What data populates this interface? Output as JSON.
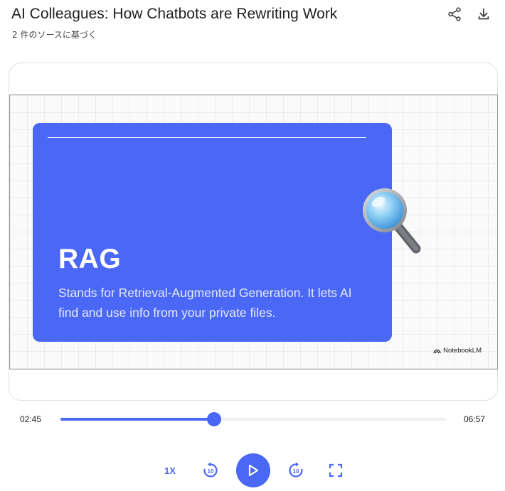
{
  "header": {
    "title": "AI Colleagues: How Chatbots are Rewriting Work",
    "subtitle": "2 件のソースに基づく",
    "share_icon": "share-icon",
    "download_icon": "download-icon"
  },
  "slide": {
    "heading": "RAG",
    "body": "Stands for Retrieval-Augmented Generation. It lets AI find and use info from your private files.",
    "image_icon": "magnifying-glass-icon",
    "watermark": "NotebookLM",
    "background_color": "#4a67f5"
  },
  "player": {
    "current_time": "02:45",
    "total_time": "06:57",
    "progress_fraction": 0.398,
    "speed_label": "1X",
    "rewind_label": "10",
    "forward_label": "10",
    "accent_color": "#4a67f5"
  }
}
